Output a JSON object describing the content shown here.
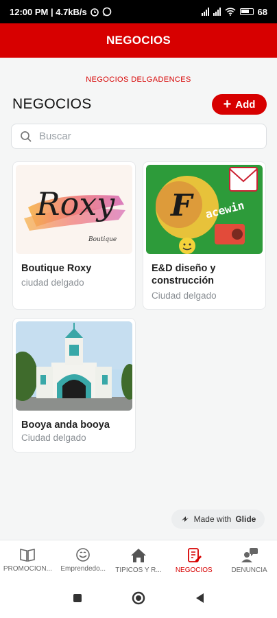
{
  "status": {
    "time_speed": "12:00 PM | 4.7kB/s",
    "battery": "68"
  },
  "appbar": {
    "title": "NEGOCIOS"
  },
  "section": {
    "caption": "NEGOCIOS DELGADENCES",
    "title": "NEGOCIOS",
    "add_label": "Add"
  },
  "search": {
    "placeholder": "Buscar"
  },
  "cards": [
    {
      "title": "Boutique Roxy",
      "subtitle": "ciudad delgado",
      "logo_text": "Roxy",
      "logo_sub": "Boutique"
    },
    {
      "title": "E&D diseño y construcción",
      "subtitle": "Ciudad delgado",
      "logo_text": "F",
      "logo_sub": "acewin"
    },
    {
      "title": "Booya anda booya",
      "subtitle": "Ciudad delgado"
    }
  ],
  "glide": {
    "prefix": "Made with",
    "brand": "Glide"
  },
  "nav": [
    {
      "label": "PROMOCION...",
      "icon": "book-icon"
    },
    {
      "label": "Emprendedo...",
      "icon": "smiley-icon"
    },
    {
      "label": "TIPICOS Y R...",
      "icon": "house-icon"
    },
    {
      "label": "NEGOCIOS",
      "icon": "edit-document-icon"
    },
    {
      "label": "DENUNCIA",
      "icon": "person-chat-icon"
    }
  ],
  "colors": {
    "accent": "#d70000",
    "background": "#f5f6f6"
  }
}
